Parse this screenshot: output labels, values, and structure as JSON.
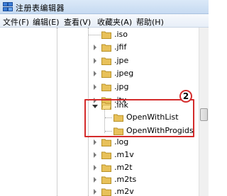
{
  "window": {
    "title": "注册表编辑器"
  },
  "menu": [
    {
      "label": "文件(F)"
    },
    {
      "label": "编辑(E)"
    },
    {
      "label": "查看(V)"
    },
    {
      "label": "收藏夹(A)"
    },
    {
      "label": "帮助(H)"
    }
  ],
  "tree": {
    "items": [
      {
        "label": ".iso"
      },
      {
        "label": ".jfif"
      },
      {
        "label": ".jpe"
      },
      {
        "label": ".jpeg"
      },
      {
        "label": ".jpg"
      },
      {
        "label": ".jtx"
      },
      {
        "label": ".lnk",
        "expanded": true
      },
      {
        "label": "OpenWithList"
      },
      {
        "label": "OpenWithProgids"
      },
      {
        "label": ".log"
      },
      {
        "label": ".m1v"
      },
      {
        "label": ".m2t"
      },
      {
        "label": ".m2ts"
      },
      {
        "label": ".m2v"
      }
    ]
  },
  "annotation": {
    "step": "2",
    "color": "#d42b2b"
  },
  "colors": {
    "folder": "#e8c15a",
    "highlight": "#d42b2b"
  }
}
